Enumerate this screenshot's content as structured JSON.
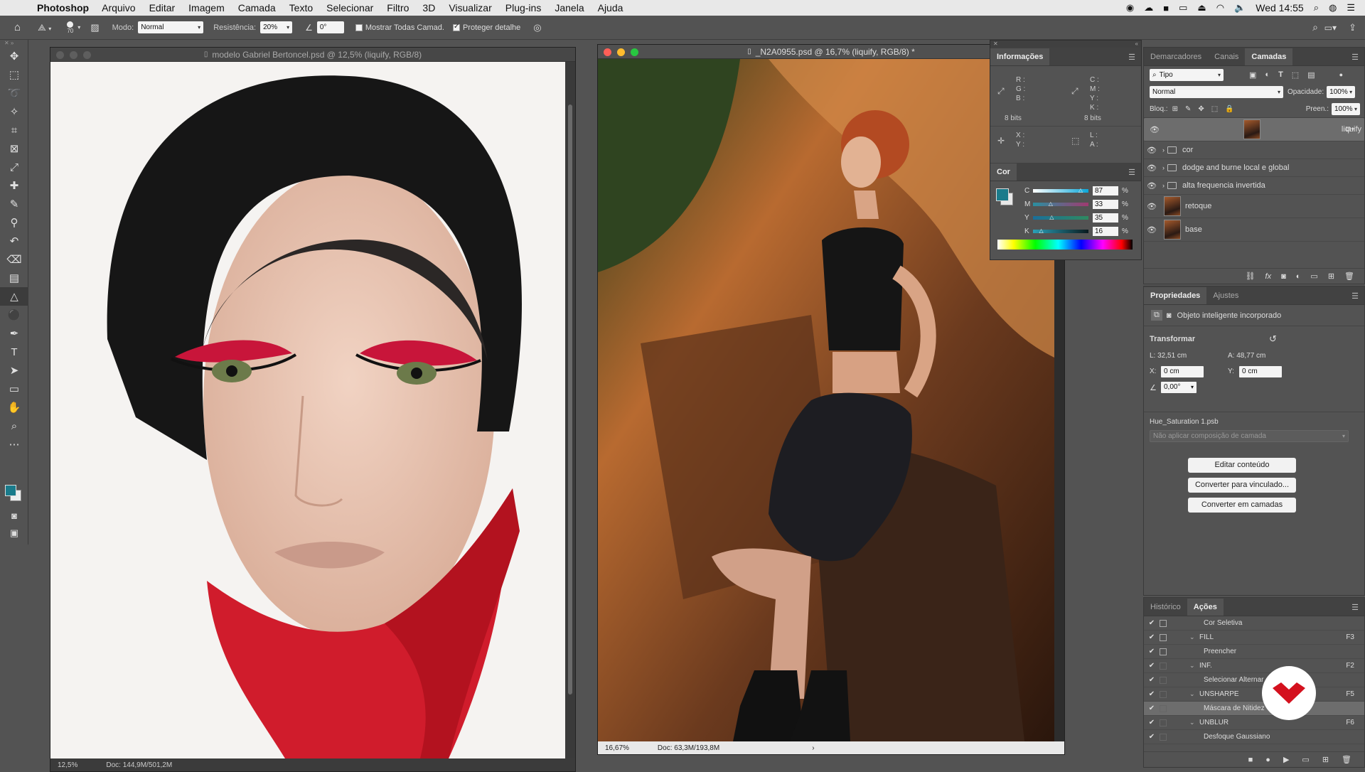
{
  "menubar": {
    "app": "Photoshop",
    "items": [
      "Arquivo",
      "Editar",
      "Imagem",
      "Camada",
      "Texto",
      "Selecionar",
      "Filtro",
      "3D",
      "Visualizar",
      "Plug-ins",
      "Janela",
      "Ajuda"
    ],
    "clock": "Wed 14:55"
  },
  "options": {
    "brush_size": "70",
    "mode_label": "Modo:",
    "mode_value": "Normal",
    "strength_label": "Resistência:",
    "strength_value": "20%",
    "angle_value": "0°",
    "sample_all": "Mostrar Todas Camad.",
    "protect_detail": "Proteger detalhe"
  },
  "doc_left": {
    "title": "modelo Gabriel Bertoncel.psd @ 12,5% (liquify, RGB/8)",
    "zoom": "12,5%",
    "doc_size": "Doc: 144,9M/501,2M"
  },
  "doc_right": {
    "title": "_N2A0955.psd @ 16,7% (liquify, RGB/8) *",
    "zoom": "16,67%",
    "doc_size": "Doc: 63,3M/193,8M"
  },
  "info_panel": {
    "tab": "Informações",
    "rgb": [
      "R :",
      "G :",
      "B :"
    ],
    "cmyk": [
      "C :",
      "M :",
      "Y :",
      "K :"
    ],
    "bits": "8 bits",
    "xy": [
      "X :",
      "Y :"
    ],
    "la": [
      "L :",
      "A :"
    ]
  },
  "color_panel": {
    "tab": "Cor",
    "fg_color": "#1a7b8b",
    "channels": [
      {
        "name": "C",
        "value": "87",
        "pct": 0.87
      },
      {
        "name": "M",
        "value": "33",
        "pct": 0.33
      },
      {
        "name": "Y",
        "value": "35",
        "pct": 0.35
      },
      {
        "name": "K",
        "value": "16",
        "pct": 0.16
      }
    ]
  },
  "layers_panel": {
    "tabs": [
      "Demarcadores",
      "Canais",
      "Camadas"
    ],
    "filter": "Tipo",
    "blend": "Normal",
    "opacity_label": "Opacidade:",
    "opacity": "100%",
    "lock_label": "Bloq.:",
    "fill_label": "Preen.:",
    "fill": "100%",
    "layers": [
      {
        "name": "liquify",
        "type": "smart",
        "selected": true
      },
      {
        "name": "cor",
        "type": "group"
      },
      {
        "name": "dodge and burne local e global",
        "type": "group"
      },
      {
        "name": "alta frequencia invertida",
        "type": "group"
      },
      {
        "name": "retoque",
        "type": "pixel"
      },
      {
        "name": "base",
        "type": "pixel"
      }
    ]
  },
  "properties_panel": {
    "tabs": [
      "Propriedades",
      "Ajustes"
    ],
    "kind": "Objeto inteligente incorporado",
    "transform_label": "Transformar",
    "w": "L: 32,51 cm",
    "h": "A: 48,77 cm",
    "x_label": "X:",
    "x": "0 cm",
    "y_label": "Y:",
    "y": "0 cm",
    "angle": "0,00°",
    "source": "Hue_Saturation 1.psb",
    "comp": "Não aplicar composição de camada",
    "buttons": [
      "Editar conteúdo",
      "Converter para vinculado...",
      "Converter em camadas"
    ]
  },
  "actions_panel": {
    "tabs": [
      "Histórico",
      "Ações"
    ],
    "rows": [
      {
        "label": "Cor Seletiva",
        "indent": 2,
        "key": "",
        "box": true,
        "twisty": ""
      },
      {
        "label": "FILL",
        "indent": 1,
        "key": "F3",
        "box": true,
        "twisty": "﹀"
      },
      {
        "label": "Preencher",
        "indent": 2,
        "key": "",
        "box": true,
        "twisty": ""
      },
      {
        "label": "INF.",
        "indent": 1,
        "key": "F2",
        "box": false,
        "twisty": "﹀"
      },
      {
        "label": "Selecionar Alternar ações...",
        "indent": 2,
        "key": "",
        "box": false,
        "twisty": ""
      },
      {
        "label": "UNSHARPE",
        "indent": 1,
        "key": "F5",
        "box": false,
        "twisty": "﹀"
      },
      {
        "label": "Máscara de Nitidez",
        "indent": 2,
        "key": "",
        "box": false,
        "twisty": "",
        "selected": true
      },
      {
        "label": "UNBLUR",
        "indent": 1,
        "key": "F6",
        "box": false,
        "twisty": "﹀"
      },
      {
        "label": "Desfoque Gaussiano",
        "indent": 2,
        "key": "",
        "box": false,
        "twisty": ""
      }
    ]
  }
}
